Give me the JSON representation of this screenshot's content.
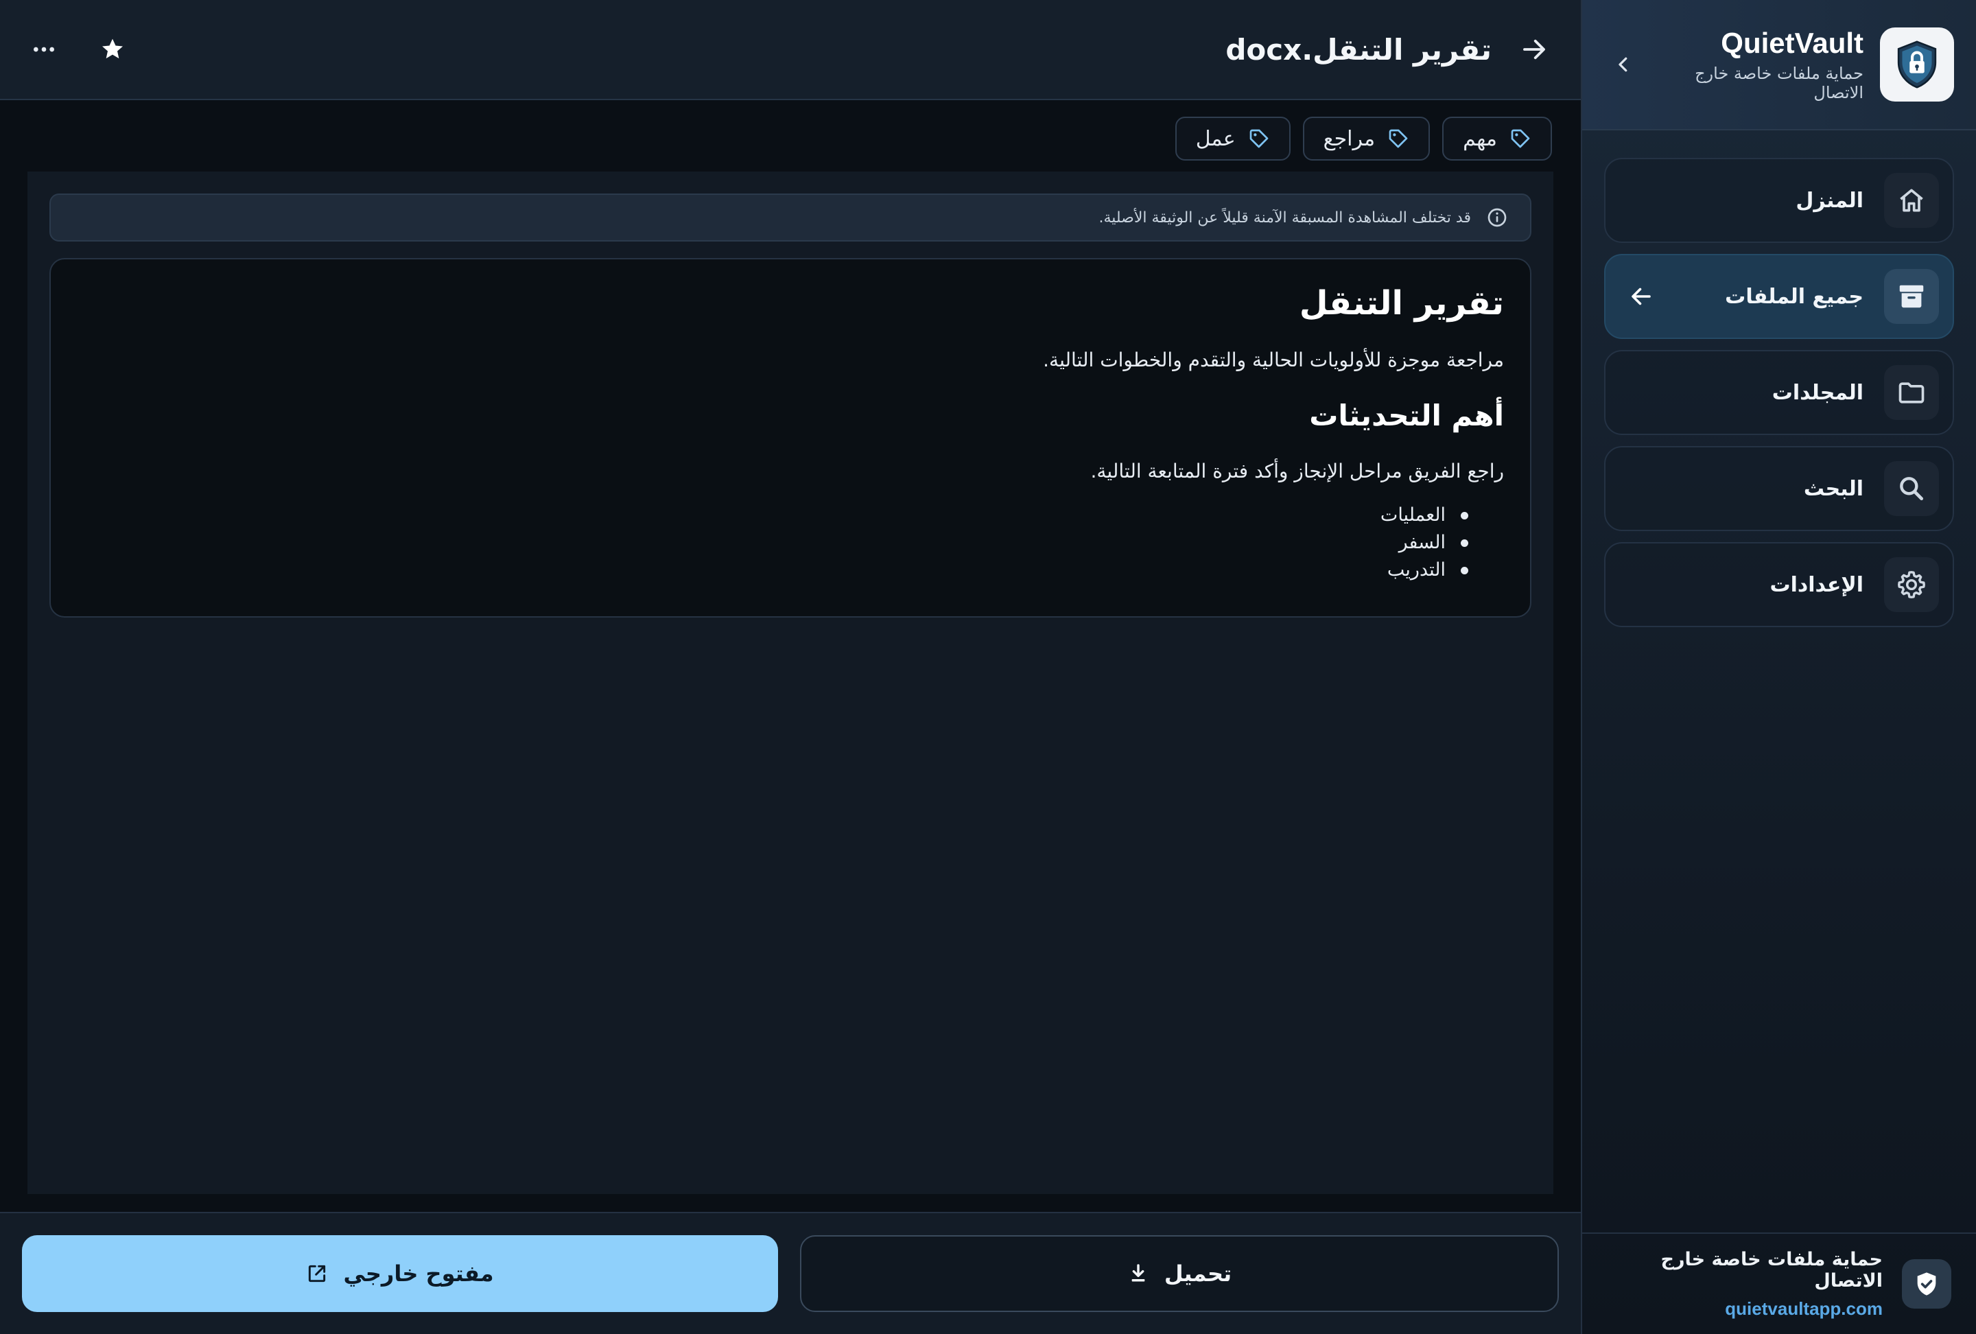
{
  "app": {
    "name": "QuietVault",
    "tagline": "حماية ملفات خاصة خارج الاتصال"
  },
  "sidebar": {
    "items": [
      {
        "label": "المنزل",
        "icon": "home-icon",
        "active": false
      },
      {
        "label": "جميع الملفات",
        "icon": "archive-icon",
        "active": true
      },
      {
        "label": "المجلدات",
        "icon": "folder-icon",
        "active": false
      },
      {
        "label": "البحث",
        "icon": "search-icon",
        "active": false
      },
      {
        "label": "الإعدادات",
        "icon": "gear-icon",
        "active": false
      }
    ],
    "footer": {
      "title": "حماية ملفات خاصة خارج الاتصال",
      "link": "quietvaultapp.com"
    }
  },
  "file": {
    "title": "تقرير التنقل.docx"
  },
  "tags": [
    {
      "label": "مهم"
    },
    {
      "label": "مراجع"
    },
    {
      "label": "عمل"
    }
  ],
  "notice": "قد تختلف المشاهدة المسبقة الآمنة قليلاً عن الوثيقة الأصلية.",
  "document": {
    "heading": "تقرير التنقل",
    "lead": "مراجعة موجزة للأولويات الحالية والتقدم والخطوات التالية.",
    "subheading": "أهم التحديثات",
    "paragraph": "راجع الفريق مراحل الإنجاز وأكد فترة المتابعة التالية.",
    "list": [
      "العمليات",
      "السفر",
      "التدريب"
    ]
  },
  "actions": {
    "download": "تحميل",
    "open_external": "مفتوح خارجي"
  },
  "colors": {
    "accent": "#8fd0fb",
    "link": "#5aa9e6",
    "active_nav": "#1d3a52"
  }
}
